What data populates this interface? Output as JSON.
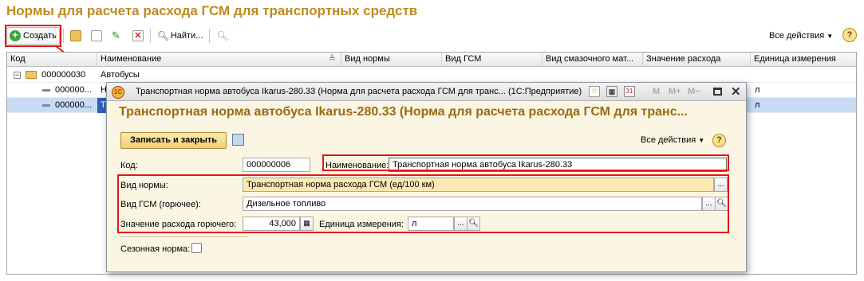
{
  "main": {
    "title": "Нормы для расчета расхода ГСМ для транспортных средств",
    "toolbar": {
      "create": "Создать",
      "find": "Найти...",
      "all_actions": "Все действия"
    },
    "columns": [
      "Код",
      "Наименование",
      "Вид нормы",
      "Вид ГСМ",
      "Вид смазочного мат...",
      "Значение расхода",
      "Единица измерения"
    ],
    "rows": [
      {
        "code": "000000030",
        "name": "Автобусы",
        "unit": ""
      },
      {
        "code": "000000...",
        "name": "Но",
        "unit": "л"
      },
      {
        "code": "000000...",
        "name": "Тр",
        "unit": "л"
      }
    ]
  },
  "dialog": {
    "window_title": "Транспортная норма автобуса Ikarus-280.33 (Норма для расчета расхода ГСМ для транс...  (1С:Предприятие)",
    "title": "Транспортная норма автобуса Ikarus-280.33 (Норма для расчета расхода ГСМ для транс...",
    "logo": "1С",
    "win_buttons": {
      "m": "M",
      "mplus": "M+",
      "mminus": "M−",
      "calendar": "31"
    },
    "save_close": "Записать и закрыть",
    "all_actions": "Все действия",
    "help": "?",
    "code_label": "Код:",
    "code_value": "000000006",
    "name_label": "Наименование:",
    "name_value": "Транспортная норма автобуса Ikarus-280.33",
    "norm_label": "Вид нормы:",
    "norm_value": "Транспортная норма расхода ГСМ (ед/100 км)",
    "fuel_label": "Вид ГСМ (горючее):",
    "fuel_value": "Дизельное топливо",
    "consumption_label": "Значение расхода горючего:",
    "consumption_value": "43,000",
    "unit_label": "Единица измерения:",
    "unit_value": "л",
    "season_label": "Сезонная норма:",
    "season_checked": false
  },
  "colors": {
    "title": "#c08a1e",
    "dialog_title": "#9a6a12",
    "highlight": "#e3151a",
    "selected_row": "#c9daf5"
  }
}
